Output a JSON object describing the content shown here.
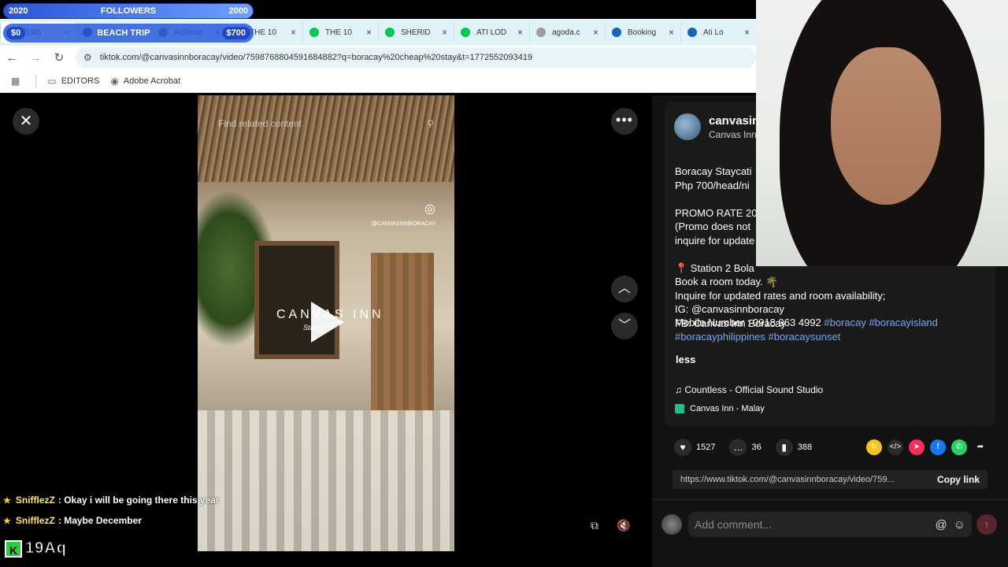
{
  "overlay": {
    "year": "2020",
    "followers_label": "FOLLOWERS",
    "followers_goal": "2000",
    "money_start": "$0",
    "goal_label": "BEACH TRIP",
    "money_goal": "$700"
  },
  "tabs": [
    {
      "label": "(538)",
      "color": "#e53935"
    },
    {
      "label": "Blo...",
      "color": "#333333"
    },
    {
      "label": "Achieve",
      "color": "#2e7d32"
    },
    {
      "label": "THE 10",
      "color": "#00c853"
    },
    {
      "label": "THE 10",
      "color": "#00c853"
    },
    {
      "label": "SHERID",
      "color": "#00c853"
    },
    {
      "label": "ATI LOD",
      "color": "#00c853"
    },
    {
      "label": "agoda.c",
      "color": "#9e9e9e"
    },
    {
      "label": "Booking",
      "color": "#1565c0"
    },
    {
      "label": "Ati Lo",
      "color": "#1565c0"
    }
  ],
  "address": {
    "url": "tiktok.com/@canvasinnboracay/video/7598768804591684882?q=boracay%20cheap%20stay&t=1772552093419"
  },
  "bookmarks": {
    "editors": "EDITORS",
    "acrobat": "Adobe Acrobat"
  },
  "video": {
    "search_placeholder": "Find related content",
    "handle": "@CANVASINNBORACAY",
    "brand": "CANVAS INN",
    "brand_sub": "Station 2"
  },
  "post": {
    "username": "canvasin",
    "nickname": "Canvas Inn",
    "desc_lines": [
      "Boracay Staycati",
      "Php 700/head/ni",
      "",
      "PROMO RATE 20",
      "(Promo does not",
      "inquire for update",
      "",
      "📍 Station 2 Bola",
      "Book a room today. 🌴",
      "Inquire for updated rates and room availability;",
      "IG: @canvasinnboracay",
      "FB: Canvas Inn Boracay"
    ],
    "mobile": "Mobile Number : 0918 963 4992",
    "tags_line1": "#boracay #boracayisland",
    "tags_line2": "#boracayphilippines #boracaysunset",
    "less": "less",
    "music": "Countless - Official Sound Studio",
    "location": "Canvas Inn - Malay",
    "likes": "1527",
    "comments": "36",
    "saves": "388",
    "link": "https://www.tiktok.com/@canvasinnboracay/video/759...",
    "copy_link": "Copy link",
    "comment_placeholder": "Add comment..."
  },
  "chat": [
    {
      "user": "SnifflezZ",
      "message": ": Okay i will be going there this year"
    },
    {
      "user": "SnifflezZ",
      "message": ": Maybe December"
    }
  ],
  "badge": {
    "letter": "K",
    "code": "19Aq"
  }
}
